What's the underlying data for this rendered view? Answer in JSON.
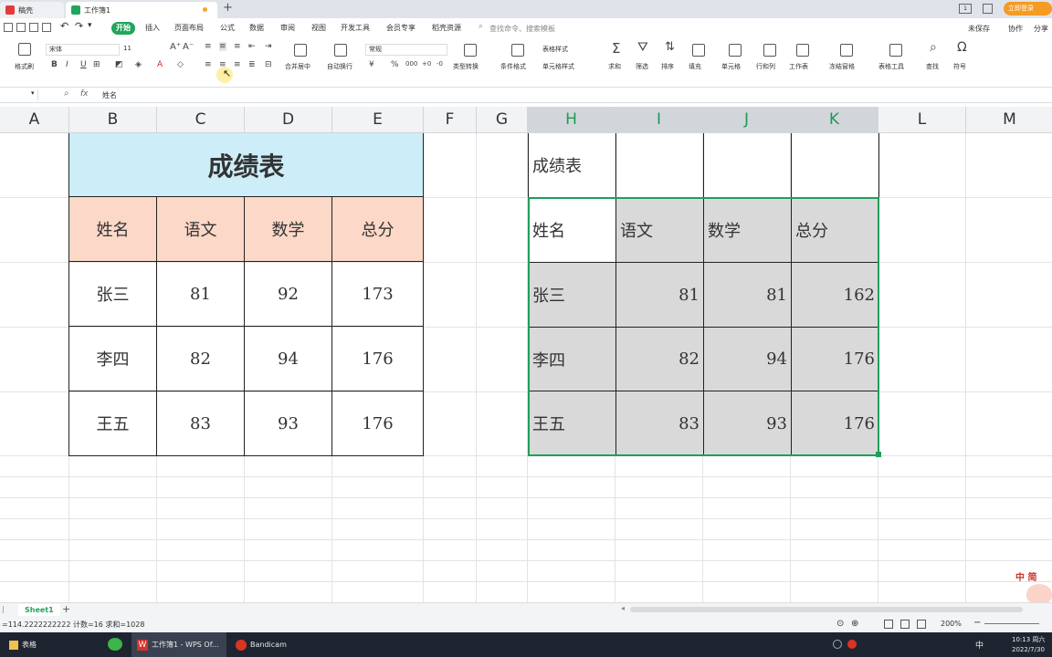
{
  "tabs": {
    "tab1": "稿壳",
    "tab2": "工作簿1",
    "new_tab": "+"
  },
  "title_right": {
    "login": "立即登录"
  },
  "menu": [
    "开始",
    "插入",
    "页面布局",
    "公式",
    "数据",
    "审阅",
    "视图",
    "开发工具",
    "会员专享",
    "稻壳资源"
  ],
  "search_placeholder": "查找命令、搜索模板",
  "top_right": {
    "unsaved": "未保存",
    "collab": "协作",
    "share": "分享"
  },
  "ribbon": {
    "format_painter": "格式刷",
    "font_name": "宋体",
    "font_size": "11",
    "bold": "B",
    "italic": "I",
    "underline": "U",
    "merge_center": "合并居中",
    "wrap_text": "自动换行",
    "number_format": "常规",
    "type_convert": "类型转换",
    "cond_format": "条件格式",
    "table_style": "表格样式",
    "cell_style": "单元格样式",
    "sum": "求和",
    "filter": "筛选",
    "sort": "排序",
    "fill": "填充",
    "cell": "单元格",
    "row_col": "行和列",
    "worksheet": "工作表",
    "freeze": "冻结窗格",
    "table_tools": "表格工具",
    "find": "查找",
    "symbol": "符号",
    "currency": "¥",
    "percent": "%"
  },
  "formula_bar": {
    "fx": "fx",
    "content": "姓名"
  },
  "columns": [
    "A",
    "B",
    "C",
    "D",
    "E",
    "F",
    "G",
    "H",
    "I",
    "J",
    "K",
    "L",
    "M"
  ],
  "left_table": {
    "title": "成绩表",
    "headers": [
      "姓名",
      "语文",
      "数学",
      "总分"
    ],
    "rows": [
      [
        "张三",
        "81",
        "92",
        "173"
      ],
      [
        "李四",
        "82",
        "94",
        "176"
      ],
      [
        "王五",
        "83",
        "93",
        "176"
      ]
    ]
  },
  "right_table": {
    "title": "成绩表",
    "headers": [
      "姓名",
      "语文",
      "数学",
      "总分"
    ],
    "rows": [
      [
        "张三",
        "81",
        "81",
        "162"
      ],
      [
        "李四",
        "82",
        "94",
        "176"
      ],
      [
        "王五",
        "83",
        "93",
        "176"
      ]
    ]
  },
  "ime_text": "中 简",
  "sheet_tab": "Sheet1",
  "status": {
    "text": "=114.2222222222 计数=16 求和=1028",
    "zoom": "200%"
  },
  "taskbar": {
    "items": [
      "表格",
      "工作簿1 - WPS Of...",
      "Bandicam"
    ],
    "time": "10:13 周六",
    "date": "2022/7/30",
    "ime": "中"
  },
  "colors": {
    "accent": "#1fa65b",
    "title_fill": "#cdeef9",
    "header_fill": "#fbd8c8",
    "selection_fill": "#d9d9d9",
    "selection_border": "#1f9f5a"
  }
}
